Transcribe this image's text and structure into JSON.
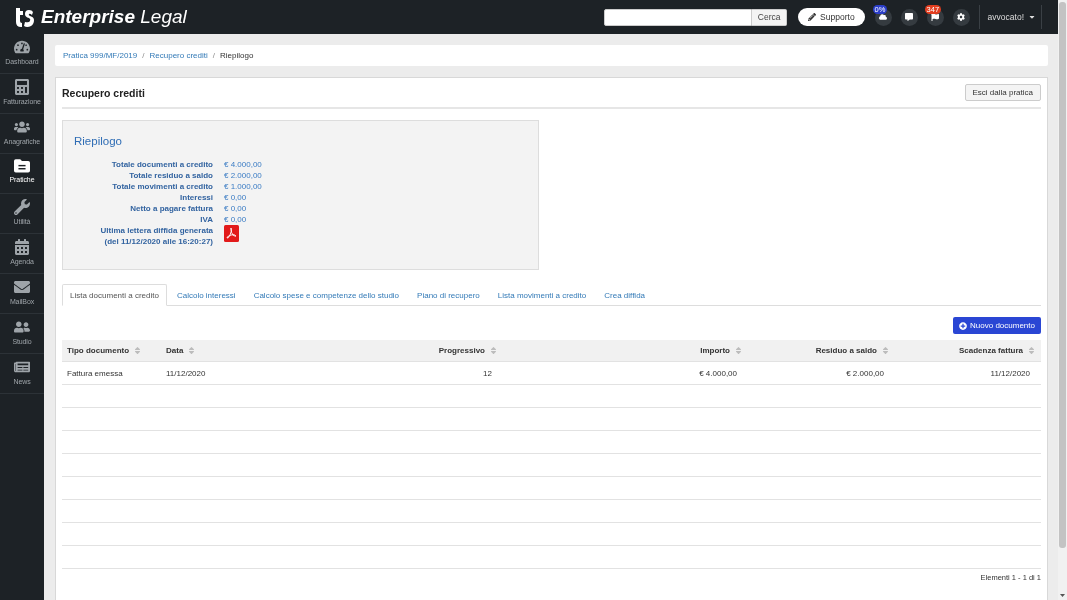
{
  "topbar": {
    "brand": "**Enterprise** Legal",
    "search_button": "Cerca",
    "support_button": "Supporto",
    "toolbar": [
      {
        "kind": "cloud",
        "badge": "0%",
        "color": "#2b3ec9"
      },
      {
        "kind": "chat"
      },
      {
        "kind": "flag",
        "badge": "347",
        "color": "#e23d1f"
      },
      {
        "kind": "settings"
      }
    ],
    "user_menu": "avvocato!"
  },
  "sidebar": {
    "items": [
      {
        "label": "Dashboard",
        "selected": false
      },
      {
        "label": "Fatturazione",
        "selected": false
      },
      {
        "label": "Anagrafiche",
        "selected": false
      },
      {
        "label": "Pratiche",
        "selected": true
      },
      {
        "label": "Utilità",
        "selected": false
      },
      {
        "label": "Agenda",
        "selected": false
      },
      {
        "label": "MailBox",
        "selected": false
      },
      {
        "label": "Studio",
        "selected": false
      },
      {
        "label": "News",
        "selected": false
      }
    ]
  },
  "breadcrumb": [
    {
      "label": "Pratica 999/MF/2019",
      "kind": "link"
    },
    {
      "label": "Recupero crediti",
      "kind": "link",
      "separator": "/"
    },
    {
      "label": "Riepilogo",
      "kind": "current",
      "separator": "/"
    }
  ],
  "panel": {
    "title": "Recupero crediti",
    "exit_button": "Esci dalla pratica"
  },
  "summary": {
    "title": "Riepilogo",
    "rows": [
      {
        "kind": "amount",
        "label": "Totale documenti a credito",
        "value": "€ 4.000,00"
      },
      {
        "kind": "amount",
        "label": "Totale residuo a saldo",
        "value": "€ 2.000,00"
      },
      {
        "kind": "amount",
        "label": "Totale movimenti a credito",
        "value": "€ 1.000,00"
      },
      {
        "kind": "amount",
        "label": "Interessi",
        "value": "€ 0,00"
      },
      {
        "kind": "amount",
        "label": "Netto a pagare fattura",
        "value": "€ 0,00"
      },
      {
        "kind": "amount",
        "label": "IVA",
        "value": "€ 0,00"
      },
      {
        "kind": "pdf",
        "label": "Ultima lettera diffida generata\n(del 11/12/2020 alle 16:20:27)"
      }
    ]
  },
  "tabs": [
    {
      "label": "Lista documenti a credito",
      "selected": true
    },
    {
      "label": "Calcolo interessi",
      "selected": false
    },
    {
      "label": "Calcolo spese e competenze dello studio",
      "selected": false
    },
    {
      "label": "Piano di recupero",
      "selected": false
    },
    {
      "label": "Lista movimenti a credito",
      "selected": false
    },
    {
      "label": "Crea diffida",
      "selected": false
    }
  ],
  "new_document_button": "Nuovo documento",
  "table": {
    "columns": [
      "Tipo documento",
      "Data",
      "Progressivo",
      "Importo",
      "Residuo a saldo",
      "Scadenza fattura"
    ],
    "rows": [
      [
        "Fattura emessa",
        "11/12/2020",
        "12",
        "€ 4.000,00",
        "€ 2.000,00",
        "11/12/2020"
      ]
    ]
  },
  "footer": "Elementi 1 - 1 di 1"
}
